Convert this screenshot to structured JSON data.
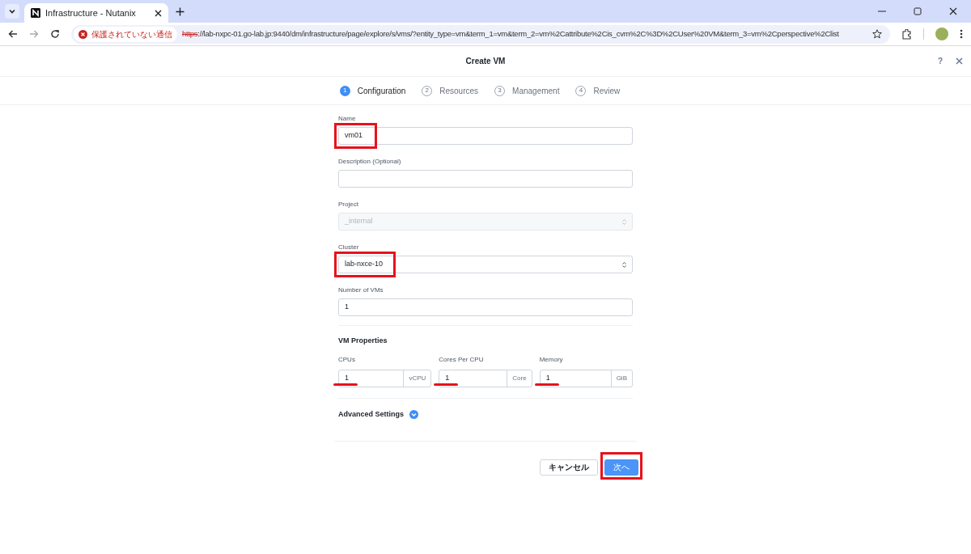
{
  "browser": {
    "tab_title": "Infrastructure - Nutanix",
    "security_label": "保護されていない通信",
    "url_scheme": "https",
    "url_rest": "://lab-nxpc-01.go-lab.jp:9440/dm/infrastructure/page/explore/s/vms/?entity_type=vm&term_1=vm&term_2=vm%2Cattribute%2Cis_cvm%2C%3D%2CUser%20VM&term_3=vm%2Cperspective%2Clist"
  },
  "dialog": {
    "title": "Create VM",
    "help": "?"
  },
  "steps": [
    {
      "number": "1",
      "label": "Configuration",
      "selected": true
    },
    {
      "number": "2",
      "label": "Resources",
      "selected": false
    },
    {
      "number": "3",
      "label": "Management",
      "selected": false
    },
    {
      "number": "4",
      "label": "Review",
      "selected": false
    }
  ],
  "fields": [
    {
      "kind": "text",
      "label": "Name",
      "value": "vm01",
      "disabled": false,
      "highlighted": true
    },
    {
      "kind": "text",
      "label": "Description (Optional)",
      "disabled": false,
      "highlighted": false
    },
    {
      "kind": "select",
      "label": "Project",
      "value": "_internal",
      "disabled": true,
      "highlighted": false
    },
    {
      "kind": "select",
      "label": "Cluster",
      "value": "lab-nxce-10",
      "disabled": false,
      "highlighted": true
    },
    {
      "kind": "text",
      "label": "Number of VMs",
      "value": "1",
      "disabled": false,
      "highlighted": false
    }
  ],
  "vm_properties": {
    "title": "VM Properties",
    "fields": [
      {
        "label": "CPUs",
        "value": "1",
        "unit": "vCPU",
        "underlined": true
      },
      {
        "label": "Cores Per CPU",
        "value": "1",
        "unit": "Core",
        "underlined": true
      },
      {
        "label": "Memory",
        "value": "1",
        "unit": "GiB",
        "underlined": true
      }
    ]
  },
  "advanced_settings": {
    "label": "Advanced Settings",
    "expanded": false
  },
  "buttons": [
    {
      "kind": "secondary",
      "label": "キャンセル",
      "highlighted": false
    },
    {
      "kind": "primary",
      "label": "次へ",
      "highlighted": true
    }
  ]
}
